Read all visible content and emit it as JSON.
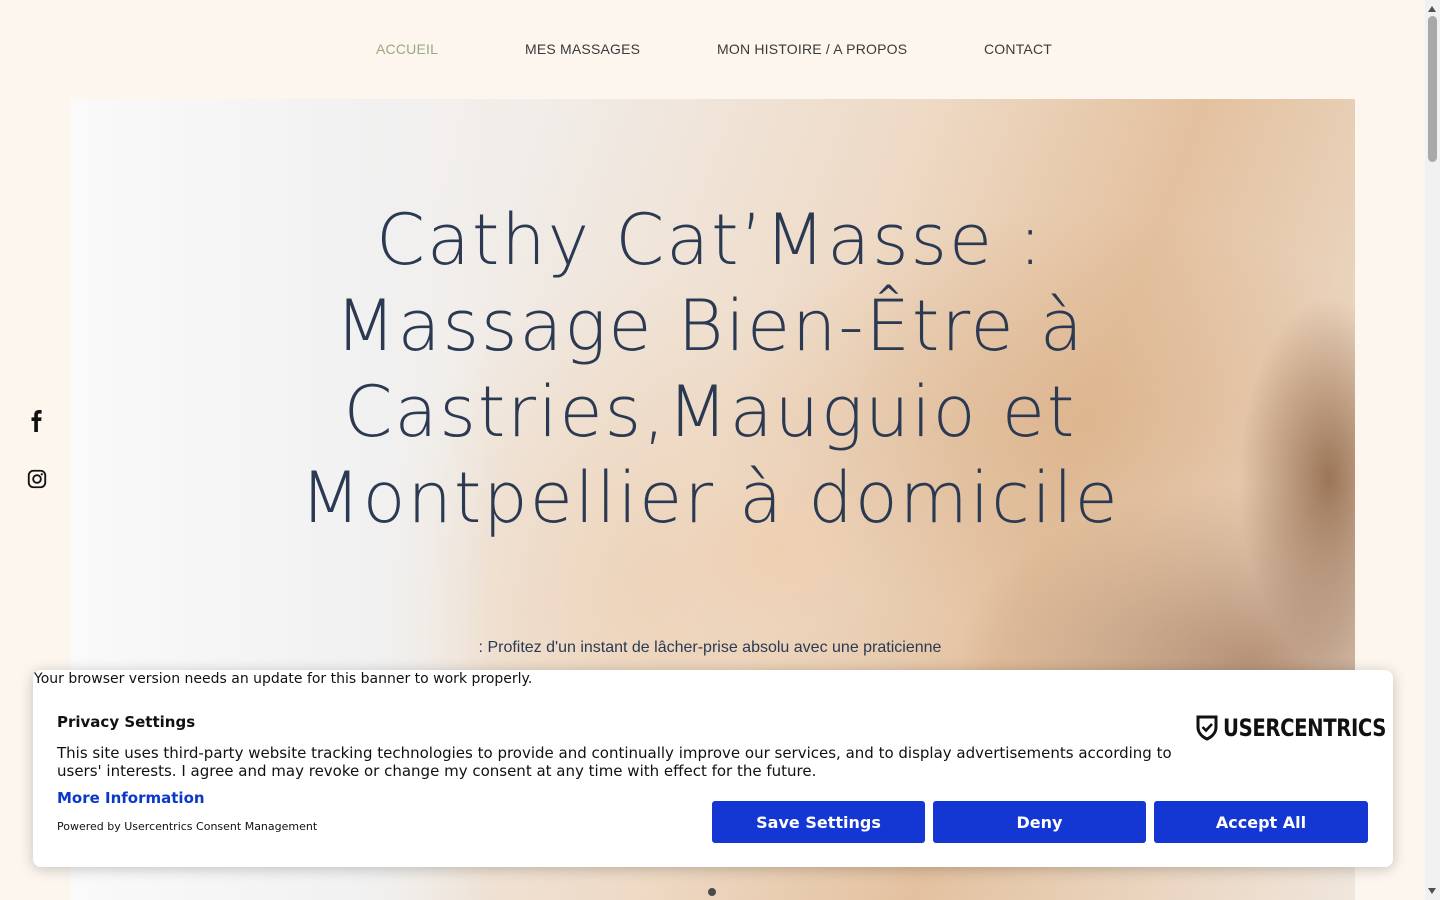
{
  "nav": {
    "items": [
      {
        "label": "ACCUEIL",
        "active": true
      },
      {
        "label": "MES MASSAGES",
        "active": false
      },
      {
        "label": "MON HISTOIRE / A PROPOS",
        "active": false
      },
      {
        "label": "CONTACT",
        "active": false
      }
    ]
  },
  "social": {
    "icons": [
      "facebook-icon",
      "instagram-icon"
    ]
  },
  "hero": {
    "title": "Cathy Cat’Masse : Massage Bien-Être à Castries,Mauguio et Montpellier à domicile",
    "subtitle": ": Profitez d'un instant de lâcher-prise absolu avec une praticienne"
  },
  "consent": {
    "browser_warning": "Your browser version needs an update for this banner to work properly.",
    "title": "Privacy Settings",
    "text": "This site uses third-party website tracking technologies to provide and continually improve our services, and to display advertisements according to users' interests. I agree and may revoke or change my consent at any time with effect for the future.",
    "more_info": "More Information",
    "powered_by": "Powered by Usercentrics Consent Management",
    "brand": "USERCENTRICS",
    "buttons": {
      "save": "Save Settings",
      "deny": "Deny",
      "accept": "Accept All"
    }
  },
  "colors": {
    "page_bg": "#fcf6ee",
    "nav_active": "#9aa884",
    "title_color": "#2b3a52",
    "button_blue": "#1437d4",
    "link_blue": "#0a38c9"
  }
}
